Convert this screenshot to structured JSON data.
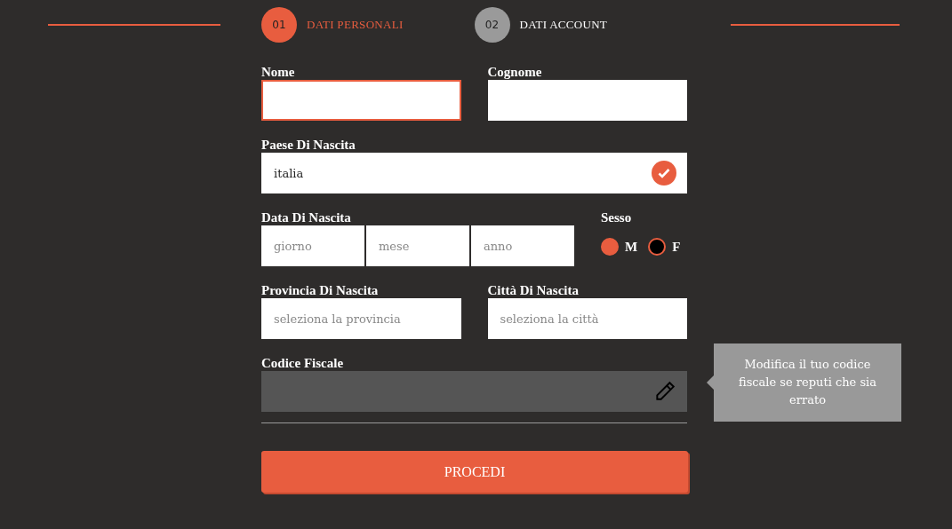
{
  "steps": [
    {
      "number": "01",
      "label": "DATI PERSONALI",
      "selected": true
    },
    {
      "number": "02",
      "label": "DATI ACCOUNT",
      "selected": false
    }
  ],
  "form": {
    "nome": {
      "label": "Nome",
      "focused": true
    },
    "cognome": {
      "label": "Cognome",
      "focused": false
    },
    "paese": {
      "label": "Paese Di Nascita",
      "value": "italia",
      "valid": true
    },
    "data": {
      "label": "Data Di Nascita",
      "parts": [
        {
          "placeholder": "giorno"
        },
        {
          "placeholder": "mese"
        },
        {
          "placeholder": "anno"
        }
      ]
    },
    "sesso": {
      "label": "Sesso",
      "options": [
        {
          "label": "M",
          "selected": true
        },
        {
          "label": "F",
          "selected": false
        }
      ]
    },
    "provincia": {
      "label": "Provincia Di Nascita",
      "placeholder": "seleziona la provincia"
    },
    "citta": {
      "label": "Città Di Nascita",
      "placeholder": "seleziona la città"
    },
    "codice_fiscale": {
      "label": "Codice Fiscale",
      "disabled": true,
      "tooltip": "Modifica il tuo codice fiscale se reputi che sia errato"
    },
    "submit": "PROCEDI"
  }
}
